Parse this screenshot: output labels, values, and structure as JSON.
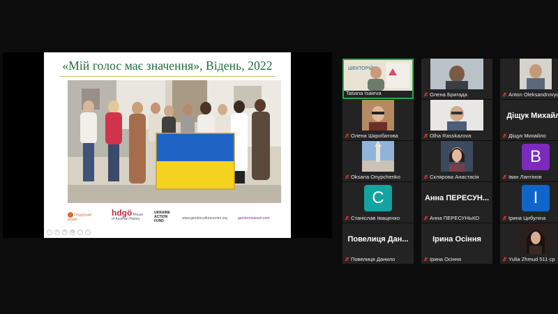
{
  "slide": {
    "title": "«Мій голос має значення», Відень, 2022",
    "logos": {
      "museum": "Гендерний музей",
      "hdgo_sub": "House of Austrian History",
      "fund": "UKRAINE ACTION FUND",
      "site1": "www.genderculturecentre.org",
      "site2": "gendermuseum.com"
    }
  },
  "colors": {
    "active_speaker": "#1fae4f",
    "accent_green": "#1d6b3a",
    "avatar_purple": "#7b2bbd",
    "avatar_teal": "#13a3a0",
    "avatar_blue": "#1066c8",
    "muted_mic": "#e53935"
  },
  "participants": [
    {
      "name": "Tatiana Isaieva",
      "type": "video",
      "active": true
    },
    {
      "name": "Олена Бригада",
      "type": "video"
    },
    {
      "name": "Anton Oleksandrovych...",
      "type": "video"
    },
    {
      "name": "Олена Шкрoбатова",
      "type": "video"
    },
    {
      "name": "Olha Rasskazova",
      "type": "video"
    },
    {
      "name": "Діщук Михайло",
      "type": "name",
      "display": "Діщук Михайло"
    },
    {
      "name": "Oksana Onypchenko",
      "type": "video"
    },
    {
      "name": "Склярова Анастасія",
      "type": "video"
    },
    {
      "name": "Іван Лантінов",
      "type": "avatar",
      "initial": "B",
      "color": "#7b2bbd"
    },
    {
      "name": "Станіслав Іващенко",
      "type": "avatar",
      "initial": "C",
      "color": "#13a3a0"
    },
    {
      "name": "Анна ПЕРЕСУНЬКО",
      "type": "name",
      "display": "Анна ПЕРЕСУН..."
    },
    {
      "name": "Ірина Цибуліна",
      "type": "avatar",
      "initial": "I",
      "color": "#1066c8"
    },
    {
      "name": "Повелиця Данило",
      "type": "name",
      "display": "Повелиця Дан..."
    },
    {
      "name": "Ірина Осіння",
      "type": "name",
      "display": "Ірина Осіння"
    },
    {
      "name": "Yulia Zhmud 511 ср",
      "type": "video"
    }
  ]
}
